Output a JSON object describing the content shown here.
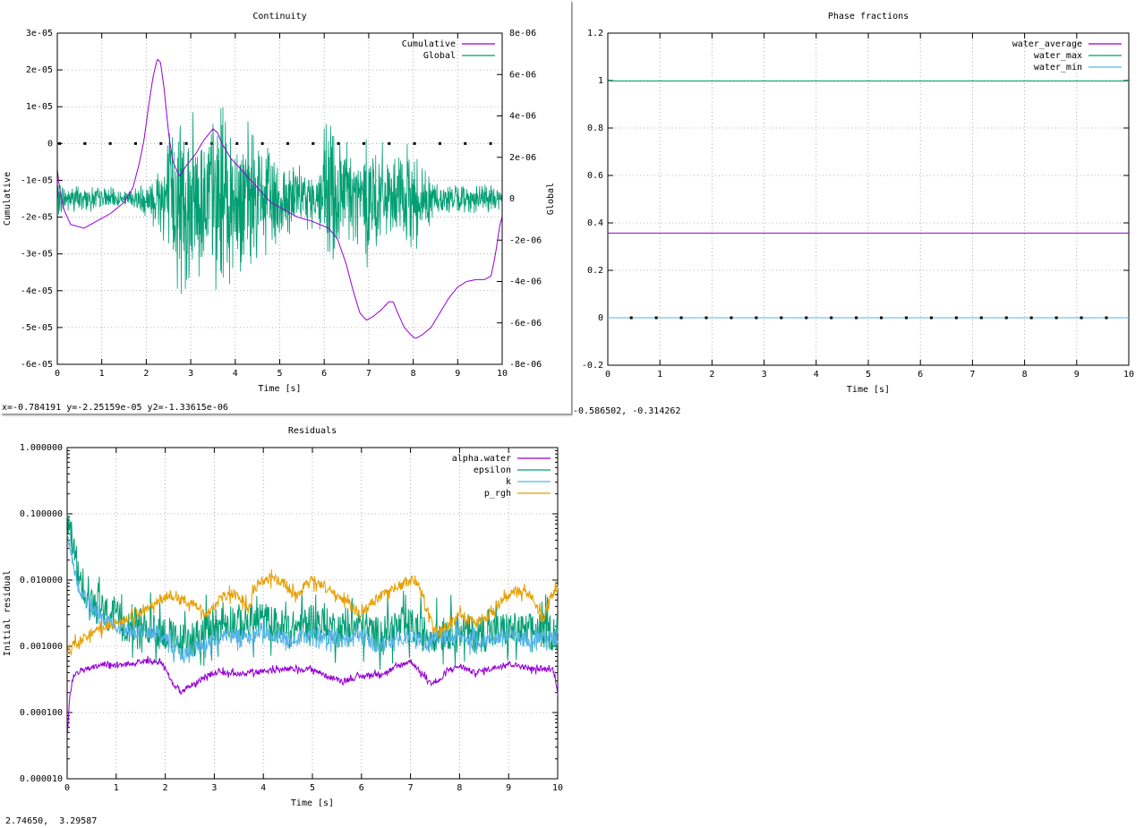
{
  "windows": {
    "continuity": {
      "status": "x=-0.784191 y=-2.25159e-05 y2=-1.33615e-06"
    },
    "phase": {
      "status": "-0.586502, -0.314262"
    },
    "residuals": {
      "status": "2.74650,  3.29587"
    }
  },
  "chart_data": [
    {
      "type": "line",
      "title": "Continuity",
      "xlabel": "Time [s]",
      "ylabel": "Cumulative",
      "y2label": "Global",
      "xlim": [
        0,
        10
      ],
      "ylim": [
        -6e-05,
        3e-05
      ],
      "y2lim": [
        -8e-06,
        8e-06
      ],
      "x_ticks": [
        "0",
        "1",
        "2",
        "3",
        "4",
        "5",
        "6",
        "7",
        "8",
        "9",
        "10"
      ],
      "y_ticks": [
        "-6e-05",
        "-5e-05",
        "-4e-05",
        "-3e-05",
        "-2e-05",
        "-1e-05",
        "0",
        "1e-05",
        "2e-05",
        "3e-05"
      ],
      "y2_ticks": [
        "-8e-06",
        "-6e-06",
        "-4e-06",
        "-2e-06",
        "0",
        "2e-06",
        "4e-06",
        "6e-06",
        "8e-06"
      ],
      "grid": true,
      "legend": "top-right",
      "colors": {
        "Cumulative": "#9400d3",
        "Global": "#009e73"
      },
      "series": [
        {
          "name": "Cumulative",
          "axis": "y",
          "x": [
            0,
            0.05,
            0.15,
            0.3,
            0.6,
            0.9,
            1.2,
            1.5,
            1.7,
            1.85,
            1.95,
            2.05,
            2.15,
            2.25,
            2.32,
            2.4,
            2.5,
            2.6,
            2.75,
            2.9,
            3.1,
            3.3,
            3.5,
            3.6,
            3.7,
            3.9,
            4.2,
            4.5,
            4.8,
            5.1,
            5.4,
            5.7,
            5.9,
            6.1,
            6.3,
            6.5,
            6.65,
            6.8,
            6.95,
            7.1,
            7.3,
            7.45,
            7.55,
            7.65,
            7.8,
            7.95,
            8.05,
            8.2,
            8.4,
            8.6,
            8.8,
            9.0,
            9.2,
            9.4,
            9.6,
            9.75,
            9.85,
            9.95,
            10
          ],
          "y": [
            -7e-06,
            -1.2e-05,
            -1.8e-05,
            -2.2e-05,
            -2.3e-05,
            -2.1e-05,
            -1.9e-05,
            -1.6e-05,
            -1.2e-05,
            -5e-06,
            1e-06,
            1e-05,
            1.8e-05,
            2.3e-05,
            2.2e-05,
            1.5e-05,
            3e-06,
            -5e-06,
            -9e-06,
            -6e-06,
            -3e-06,
            1e-06,
            4e-06,
            3e-06,
            0,
            -4e-06,
            -8e-06,
            -1.2e-05,
            -1.6e-05,
            -1.8e-05,
            -2e-05,
            -2.1e-05,
            -2.2e-05,
            -2.3e-05,
            -2.6e-05,
            -3.3e-05,
            -4e-05,
            -4.6e-05,
            -4.8e-05,
            -4.7e-05,
            -4.5e-05,
            -4.3e-05,
            -4.3e-05,
            -4.6e-05,
            -5e-05,
            -5.2e-05,
            -5.3e-05,
            -5.2e-05,
            -5e-05,
            -4.6e-05,
            -4.2e-05,
            -3.9e-05,
            -3.75e-05,
            -3.7e-05,
            -3.7e-05,
            -3.6e-05,
            -3e-05,
            -2.2e-05,
            -2e-05
          ]
        },
        {
          "name": "Global",
          "axis": "y2",
          "x": [
            0,
            1.2,
            1.5,
            2.1,
            2.5,
            2.8,
            3.0,
            3.2,
            3.5,
            3.7,
            4.0,
            4.5,
            5.0,
            5.4,
            5.8,
            6.1,
            6.4,
            6.8,
            7.0,
            7.2,
            7.5,
            7.7,
            8.0,
            8.5,
            9.0,
            9.5,
            10
          ],
          "envelope": [
            9e-07,
            6e-07,
            4e-07,
            1.2e-06,
            4e-06,
            5.5e-06,
            4.5e-06,
            4.5e-06,
            4.8e-06,
            5.5e-06,
            4.5e-06,
            3.5e-06,
            2.8e-06,
            1.8e-06,
            1.5e-06,
            5e-06,
            4e-06,
            2.5e-06,
            4e-06,
            3.5e-06,
            1.8e-06,
            2.5e-06,
            3e-06,
            1e-06,
            8e-07,
            8e-07,
            7e-07
          ]
        }
      ]
    },
    {
      "type": "line",
      "title": "Phase fractions",
      "xlabel": "Time [s]",
      "ylabel": "",
      "xlim": [
        0,
        10
      ],
      "ylim": [
        -0.2,
        1.2
      ],
      "x_ticks": [
        "0",
        "1",
        "2",
        "3",
        "4",
        "5",
        "6",
        "7",
        "8",
        "9",
        "10"
      ],
      "y_ticks": [
        "-0.2",
        "0",
        "0.2",
        "0.4",
        "0.6",
        "0.8",
        "1",
        "1.2"
      ],
      "grid": true,
      "legend": "top-right",
      "colors": {
        "water_average": "#9400d3",
        "water_max": "#009e73",
        "water_min": "#56b4e9"
      },
      "series": [
        {
          "name": "water_average",
          "x": [
            0,
            10
          ],
          "y": [
            0.357,
            0.357
          ]
        },
        {
          "name": "water_max",
          "x": [
            0,
            10
          ],
          "y": [
            0.998,
            0.998
          ]
        },
        {
          "name": "water_min",
          "x": [
            0,
            10
          ],
          "y": [
            0,
            0
          ]
        }
      ]
    },
    {
      "type": "line",
      "title": "Residuals",
      "xlabel": "Time [s]",
      "ylabel": "Initial residual",
      "scale_y": "log",
      "xlim": [
        0,
        10
      ],
      "ylim": [
        1e-05,
        1
      ],
      "x_ticks": [
        "0",
        "1",
        "2",
        "3",
        "4",
        "5",
        "6",
        "7",
        "8",
        "9",
        "10"
      ],
      "y_ticks": [
        "0.000010",
        "0.000100",
        "0.001000",
        "0.010000",
        "0.100000",
        "1.000000"
      ],
      "grid": true,
      "legend": "top-right",
      "colors": {
        "alpha.water": "#9400d3",
        "epsilon": "#009e73",
        "k": "#56b4e9",
        "p_rgh": "#e69f00"
      },
      "series": [
        {
          "name": "alpha.water",
          "x": [
            0,
            0.02,
            0.06,
            0.1,
            0.2,
            0.4,
            0.6,
            0.8,
            1.0,
            1.3,
            1.6,
            1.9,
            2.0,
            2.1,
            2.3,
            2.5,
            2.7,
            3.0,
            3.3,
            3.6,
            4.0,
            4.5,
            5.0,
            5.3,
            5.6,
            6.0,
            6.5,
            7.0,
            7.2,
            7.4,
            7.6,
            7.8,
            8.0,
            8.3,
            8.6,
            9.0,
            9.5,
            9.9,
            10
          ],
          "y": [
            5e-05,
            6e-05,
            0.0002,
            0.0003,
            0.0004,
            0.00045,
            0.0005,
            0.00055,
            0.0005,
            0.00055,
            0.0006,
            0.00058,
            0.0005,
            0.0003,
            0.0002,
            0.00025,
            0.0003,
            0.0004,
            0.0004,
            0.00038,
            0.00042,
            0.00045,
            0.00045,
            0.00035,
            0.0003,
            0.00035,
            0.0004,
            0.0006,
            0.0004,
            0.00028,
            0.0003,
            0.00045,
            0.0005,
            0.0004,
            0.00045,
            0.00055,
            0.00045,
            0.00045,
            0.0002
          ]
        },
        {
          "name": "epsilon",
          "x": [
            0,
            0.05,
            0.2,
            0.4,
            0.6,
            0.8,
            1.0,
            1.2,
            1.5,
            1.8,
            2.0,
            2.2,
            2.4,
            2.6,
            2.8,
            3.0,
            3.3,
            3.6,
            4.0,
            4.3,
            4.6,
            5.0,
            5.3,
            5.6,
            6.0,
            6.3,
            6.6,
            7.0,
            7.3,
            7.6,
            8.0,
            8.3,
            8.6,
            9.0,
            9.3,
            9.6,
            10
          ],
          "y": [
            0.07,
            0.05,
            0.012,
            0.007,
            0.004,
            0.003,
            0.0025,
            0.0022,
            0.002,
            0.0018,
            0.0016,
            0.0012,
            0.0012,
            0.0014,
            0.0016,
            0.002,
            0.0025,
            0.0022,
            0.0025,
            0.002,
            0.0018,
            0.0025,
            0.002,
            0.0018,
            0.002,
            0.0015,
            0.0018,
            0.002,
            0.0015,
            0.0016,
            0.0018,
            0.0015,
            0.0016,
            0.0018,
            0.0016,
            0.0018,
            0.0016
          ]
        },
        {
          "name": "k",
          "x": [
            0,
            0.05,
            0.2,
            0.4,
            0.6,
            0.8,
            1.0,
            1.2,
            1.5,
            1.8,
            2.0,
            2.2,
            2.4,
            2.6,
            2.8,
            3.0,
            3.3,
            3.6,
            4.0,
            4.3,
            4.6,
            5.0,
            5.3,
            5.6,
            6.0,
            6.3,
            6.6,
            7.0,
            7.3,
            7.6,
            8.0,
            8.3,
            8.6,
            9.0,
            9.3,
            9.6,
            10
          ],
          "y": [
            0.05,
            0.03,
            0.008,
            0.005,
            0.003,
            0.0025,
            0.002,
            0.0018,
            0.0016,
            0.0015,
            0.0013,
            0.0009,
            0.0007,
            0.0009,
            0.0011,
            0.0013,
            0.0015,
            0.0013,
            0.0016,
            0.0014,
            0.0012,
            0.0016,
            0.0014,
            0.0012,
            0.0014,
            0.001,
            0.0012,
            0.0014,
            0.0012,
            0.0013,
            0.0014,
            0.0012,
            0.0013,
            0.0014,
            0.0013,
            0.0014,
            0.0013
          ]
        },
        {
          "name": "p_rgh",
          "x": [
            0,
            0.2,
            0.5,
            0.8,
            1.0,
            1.3,
            1.6,
            1.9,
            2.1,
            2.3,
            2.6,
            2.8,
            3.0,
            3.2,
            3.5,
            3.7,
            3.9,
            4.2,
            4.5,
            4.7,
            5.0,
            5.2,
            5.5,
            5.8,
            6.0,
            6.3,
            6.6,
            6.9,
            7.1,
            7.3,
            7.5,
            7.8,
            8.0,
            8.3,
            8.6,
            8.9,
            9.1,
            9.4,
            9.7,
            10
          ],
          "y": [
            0.0009,
            0.0011,
            0.0016,
            0.002,
            0.0022,
            0.0028,
            0.0035,
            0.005,
            0.006,
            0.005,
            0.0045,
            0.003,
            0.004,
            0.006,
            0.006,
            0.0035,
            0.009,
            0.011,
            0.008,
            0.006,
            0.01,
            0.008,
            0.006,
            0.004,
            0.003,
            0.005,
            0.007,
            0.009,
            0.01,
            0.004,
            0.0018,
            0.002,
            0.003,
            0.0022,
            0.003,
            0.005,
            0.007,
            0.006,
            0.0025,
            0.008
          ]
        }
      ]
    }
  ]
}
